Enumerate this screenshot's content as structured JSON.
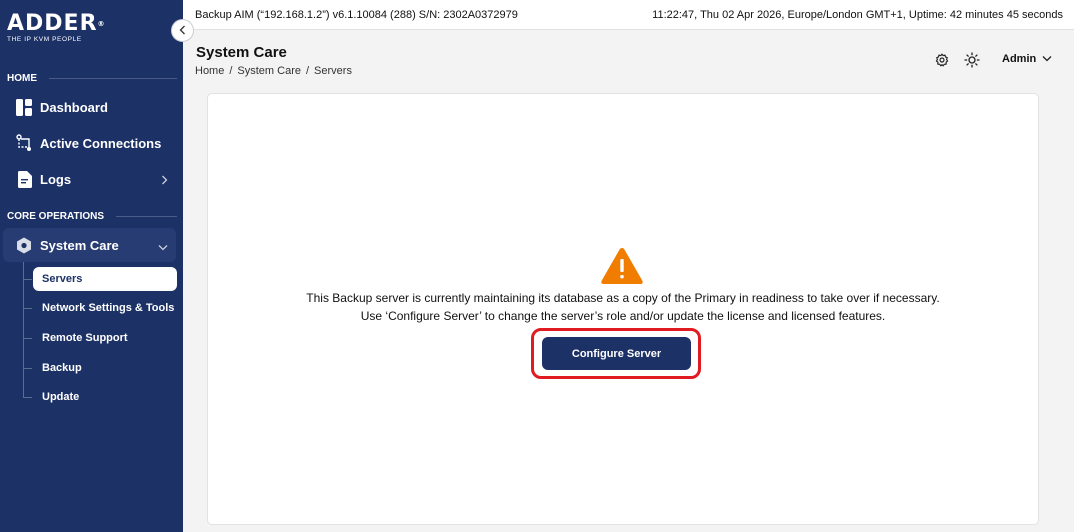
{
  "brand": {
    "name": "ADDER",
    "trademark": "®",
    "tagline": "THE IP KVM PEOPLE"
  },
  "topbar": {
    "server_info": "Backup AIM (“192.168.1.2”) v6.1.10084 (288) S/N: 2302A0372979",
    "status": "11:22:47, Thu 02 Apr 2026, Europe/London GMT+1, Uptime: 42 minutes 45 seconds"
  },
  "sidebar": {
    "sections": [
      {
        "label": "HOME"
      },
      {
        "label": "CORE OPERATIONS"
      }
    ],
    "items": [
      {
        "label": "Dashboard",
        "icon": "dashboard-icon"
      },
      {
        "label": "Active Connections",
        "icon": "connections-icon"
      },
      {
        "label": "Logs",
        "icon": "logs-icon"
      },
      {
        "label": "System Care",
        "icon": "system-care-icon"
      }
    ],
    "subitems": [
      {
        "label": "Servers",
        "active": true
      },
      {
        "label": "Network Settings & Tools"
      },
      {
        "label": "Remote Support"
      },
      {
        "label": "Backup"
      },
      {
        "label": "Update"
      }
    ]
  },
  "header": {
    "title": "System Care",
    "breadcrumb": [
      "Home",
      "System Care",
      "Servers"
    ],
    "breadcrumb_sep": "/",
    "user": "Admin"
  },
  "main": {
    "message_line1": "This Backup server is currently maintaining its database as a copy of the Primary in readiness to take over if necessary.",
    "message_line2": "Use ‘Configure Server’ to change the server’s role and/or update the license and licensed features.",
    "configure_button": "Configure Server"
  },
  "colors": {
    "sidebar_bg": "#1c3166",
    "accent": "#1c3166",
    "warning": "#f07d00",
    "highlight": "#e01b22"
  }
}
